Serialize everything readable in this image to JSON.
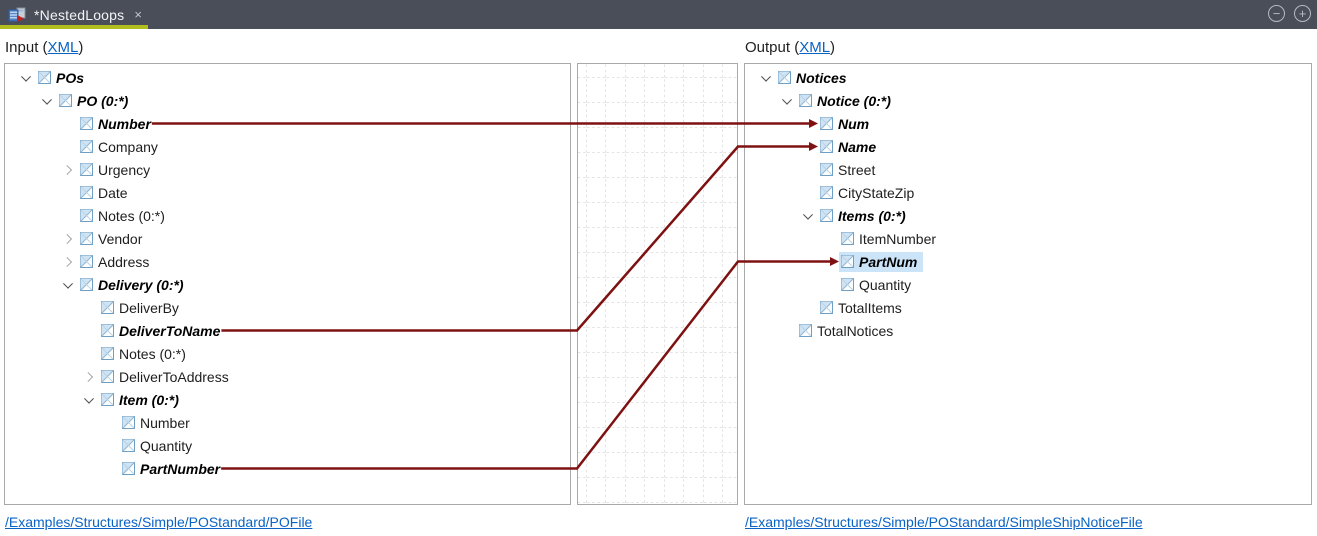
{
  "tab_bar": {
    "title": "*NestedLoops",
    "close_glyph": "×",
    "accent_color": "#b2be1e",
    "background_color": "#4a4e59",
    "window_controls": [
      {
        "name": "collapse-button",
        "glyph": "−"
      },
      {
        "name": "expand-button",
        "glyph": "+"
      }
    ]
  },
  "input_section": {
    "header_prefix": "Input (",
    "header_link": "XML",
    "header_suffix": ")",
    "footer_link": "/Examples/Structures/Simple/POStandard/POFile"
  },
  "output_section": {
    "header_prefix": "Output (",
    "header_link": "XML",
    "header_suffix": ")",
    "footer_link": "/Examples/Structures/Simple/POStandard/SimpleShipNoticeFile"
  },
  "input_tree": {
    "nodes": [
      {
        "label": "POs",
        "level": 0,
        "expander": "open",
        "emphasis": true
      },
      {
        "label": "PO (0:*)",
        "level": 1,
        "expander": "open",
        "emphasis": true
      },
      {
        "label": "Number",
        "level": 2,
        "expander": "none",
        "emphasis": true
      },
      {
        "label": "Company",
        "level": 2,
        "expander": "none",
        "emphasis": false
      },
      {
        "label": "Urgency",
        "level": 2,
        "expander": "closed",
        "emphasis": false
      },
      {
        "label": "Date",
        "level": 2,
        "expander": "none",
        "emphasis": false
      },
      {
        "label": "Notes (0:*)",
        "level": 2,
        "expander": "none",
        "emphasis": false
      },
      {
        "label": "Vendor",
        "level": 2,
        "expander": "closed",
        "emphasis": false
      },
      {
        "label": "Address",
        "level": 2,
        "expander": "closed",
        "emphasis": false
      },
      {
        "label": "Delivery (0:*)",
        "level": 2,
        "expander": "open",
        "emphasis": true
      },
      {
        "label": "DeliverBy",
        "level": 3,
        "expander": "none",
        "emphasis": false
      },
      {
        "label": "DeliverToName",
        "level": 3,
        "expander": "none",
        "emphasis": true
      },
      {
        "label": "Notes (0:*)",
        "level": 3,
        "expander": "none",
        "emphasis": false
      },
      {
        "label": "DeliverToAddress",
        "level": 3,
        "expander": "closed",
        "emphasis": false
      },
      {
        "label": "Item (0:*)",
        "level": 3,
        "expander": "open",
        "emphasis": true
      },
      {
        "label": "Number",
        "level": 4,
        "expander": "none",
        "emphasis": false
      },
      {
        "label": "Quantity",
        "level": 4,
        "expander": "none",
        "emphasis": false
      },
      {
        "label": "PartNumber",
        "level": 4,
        "expander": "none",
        "emphasis": true
      }
    ]
  },
  "output_tree": {
    "nodes": [
      {
        "label": "Notices",
        "level": 0,
        "expander": "open",
        "emphasis": true
      },
      {
        "label": "Notice (0:*)",
        "level": 1,
        "expander": "open",
        "emphasis": true
      },
      {
        "label": "Num",
        "level": 2,
        "expander": "none",
        "emphasis": true
      },
      {
        "label": "Name",
        "level": 2,
        "expander": "none",
        "emphasis": true
      },
      {
        "label": "Street",
        "level": 2,
        "expander": "none",
        "emphasis": false
      },
      {
        "label": "CityStateZip",
        "level": 2,
        "expander": "none",
        "emphasis": false
      },
      {
        "label": "Items (0:*)",
        "level": 2,
        "expander": "open",
        "emphasis": true
      },
      {
        "label": "ItemNumber",
        "level": 3,
        "expander": "none",
        "emphasis": false
      },
      {
        "label": "PartNum",
        "level": 3,
        "expander": "none",
        "emphasis": true,
        "selected": true
      },
      {
        "label": "Quantity",
        "level": 3,
        "expander": "none",
        "emphasis": false
      },
      {
        "label": "TotalItems",
        "level": 2,
        "expander": "none",
        "emphasis": false
      },
      {
        "label": "TotalNotices",
        "level": 1,
        "expander": "none",
        "emphasis": false
      }
    ]
  },
  "connections": [
    {
      "from_index": 2,
      "from_label": "Number",
      "to_index": 2,
      "to_label": "Num"
    },
    {
      "from_index": 11,
      "from_label": "DeliverToName",
      "to_index": 3,
      "to_label": "Name"
    },
    {
      "from_index": 17,
      "from_label": "PartNumber",
      "to_index": 8,
      "to_label": "PartNum"
    }
  ],
  "colors": {
    "connector": "#7e1111",
    "selection": "#cbe4f8",
    "link": "#0a63c4",
    "grid_line": "#c8c8c8"
  }
}
